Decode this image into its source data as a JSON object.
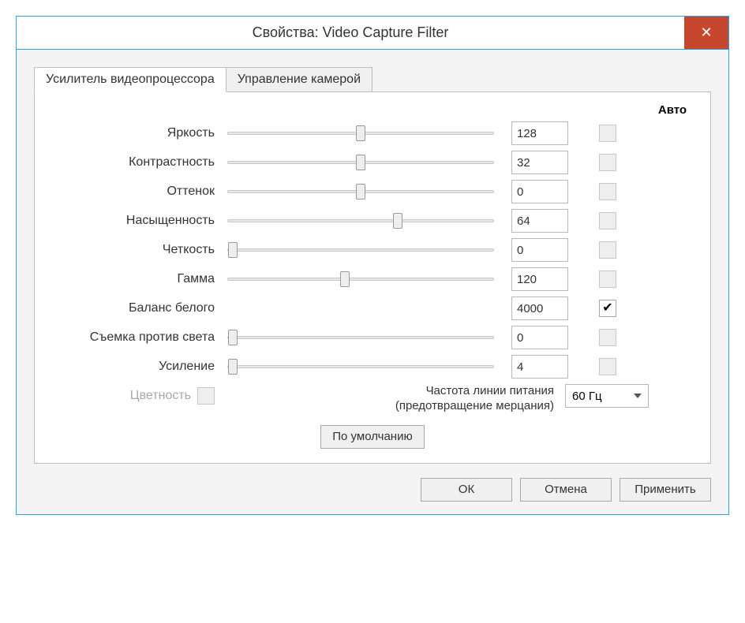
{
  "window": {
    "title": "Свойства: Video Capture Filter",
    "close_glyph": "✕"
  },
  "tabs": {
    "t0": "Усилитель видеопроцессора",
    "t1": "Управление камерой"
  },
  "headers": {
    "auto": "Авто"
  },
  "controls": [
    {
      "key": "brightness",
      "label": "Яркость",
      "value": "128",
      "pos": 50,
      "auto_enabled": false,
      "auto_checked": false,
      "enabled": true
    },
    {
      "key": "contrast",
      "label": "Контрастность",
      "value": "32",
      "pos": 50,
      "auto_enabled": false,
      "auto_checked": false,
      "enabled": true
    },
    {
      "key": "hue",
      "label": "Оттенок",
      "value": "0",
      "pos": 50,
      "auto_enabled": false,
      "auto_checked": false,
      "enabled": true
    },
    {
      "key": "saturation",
      "label": "Насыщенность",
      "value": "64",
      "pos": 64,
      "auto_enabled": false,
      "auto_checked": false,
      "enabled": true
    },
    {
      "key": "sharpness",
      "label": "Четкость",
      "value": "0",
      "pos": 2,
      "auto_enabled": false,
      "auto_checked": false,
      "enabled": true
    },
    {
      "key": "gamma",
      "label": "Гамма",
      "value": "120",
      "pos": 44,
      "auto_enabled": false,
      "auto_checked": false,
      "enabled": true
    },
    {
      "key": "wb",
      "label": "Баланс белого",
      "value": "4000",
      "pos": null,
      "auto_enabled": true,
      "auto_checked": true,
      "enabled": true,
      "no_slider": true
    },
    {
      "key": "backlight",
      "label": "Съемка против света",
      "value": "0",
      "pos": 2,
      "auto_enabled": false,
      "auto_checked": false,
      "enabled": true
    },
    {
      "key": "gain",
      "label": "Усиление",
      "value": "4",
      "pos": 2,
      "auto_enabled": false,
      "auto_checked": false,
      "enabled": true
    }
  ],
  "color_enable": {
    "label": "Цветность",
    "enabled": false
  },
  "powerline": {
    "label": "Частота линии питания (предотвращение мерцания)",
    "value": "60 Гц"
  },
  "defaults_btn": "По умолчанию",
  "buttons": {
    "ok": "ОК",
    "cancel": "Отмена",
    "apply": "Применить"
  }
}
